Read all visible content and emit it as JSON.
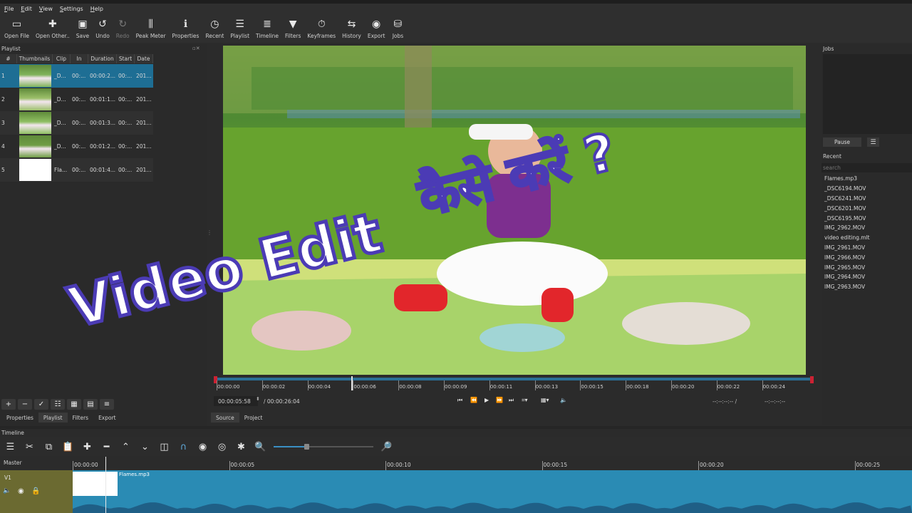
{
  "menu": [
    "File",
    "Edit",
    "View",
    "Settings",
    "Help"
  ],
  "toolbar": [
    {
      "label": "Open File",
      "icon": "open-file-icon",
      "glyph": "▭",
      "disabled": false
    },
    {
      "label": "Open Other..",
      "icon": "open-other-icon",
      "glyph": "✚",
      "disabled": false
    },
    {
      "label": "Save",
      "icon": "save-icon",
      "glyph": "▣",
      "disabled": false
    },
    {
      "label": "Undo",
      "icon": "undo-icon",
      "glyph": "↺",
      "disabled": false
    },
    {
      "label": "Redo",
      "icon": "redo-icon",
      "glyph": "↻",
      "disabled": true
    },
    {
      "label": "Peak Meter",
      "icon": "peak-meter-icon",
      "glyph": "⫼",
      "disabled": false
    },
    {
      "label": "Properties",
      "icon": "properties-icon",
      "glyph": "ℹ",
      "disabled": false
    },
    {
      "label": "Recent",
      "icon": "recent-icon",
      "glyph": "◷",
      "disabled": false
    },
    {
      "label": "Playlist",
      "icon": "playlist-icon",
      "glyph": "☰",
      "disabled": false
    },
    {
      "label": "Timeline",
      "icon": "timeline-icon",
      "glyph": "≣",
      "disabled": false
    },
    {
      "label": "Filters",
      "icon": "filters-icon",
      "glyph": "▼",
      "disabled": false
    },
    {
      "label": "Keyframes",
      "icon": "keyframes-icon",
      "glyph": "⏱",
      "disabled": false
    },
    {
      "label": "History",
      "icon": "history-icon",
      "glyph": "⇆",
      "disabled": false
    },
    {
      "label": "Export",
      "icon": "export-icon",
      "glyph": "◉",
      "disabled": false
    },
    {
      "label": "Jobs",
      "icon": "jobs-icon",
      "glyph": "⛁",
      "disabled": false
    }
  ],
  "playlist": {
    "title": "Playlist",
    "columns": [
      "#",
      "Thumbnails",
      "Clip",
      "In",
      "Duration",
      "Start",
      "Date"
    ],
    "rows": [
      {
        "n": "1",
        "clip": "_D...",
        "in": "00:...",
        "duration": "00:00:2...",
        "start": "00:...",
        "date": "201...",
        "thumb": "#7fb35a"
      },
      {
        "n": "2",
        "clip": "_D...",
        "in": "00:...",
        "duration": "00:01:1...",
        "start": "00:...",
        "date": "201...",
        "thumb": "#9cc06a"
      },
      {
        "n": "3",
        "clip": "_D...",
        "in": "00:...",
        "duration": "00:01:3...",
        "start": "00:...",
        "date": "201...",
        "thumb": "#8fbf62"
      },
      {
        "n": "4",
        "clip": "_D...",
        "in": "00:...",
        "duration": "00:01:2...",
        "start": "00:...",
        "date": "201...",
        "thumb": "#6f9d45"
      },
      {
        "n": "5",
        "clip": "Fla...",
        "in": "00:...",
        "duration": "00:01:4...",
        "start": "00:...",
        "date": "201...",
        "thumb": "#ffffff"
      }
    ],
    "footer_tabs": [
      "Properties",
      "Playlist",
      "Filters",
      "Export"
    ]
  },
  "overlay": {
    "line1": "Video Edit",
    "line2": "कैसे करें ?"
  },
  "player": {
    "ruler_ticks": [
      "00:00:00",
      "00:00:02",
      "00:00:04",
      "00:00:06",
      "00:00:08",
      "00:00:09",
      "00:00:11",
      "00:00:13",
      "00:00:15",
      "00:00:18",
      "00:00:20",
      "00:00:22",
      "00:00:24"
    ],
    "current_time": "00:00:05:58",
    "total_time": "/ 00:00:26:04",
    "in_point": "--:--:--:-- /",
    "out_point": "--:--:--:--",
    "tabs": [
      "Source",
      "Project"
    ]
  },
  "jobs": {
    "title": "Jobs",
    "pause_label": "Pause",
    "menu_glyph": "☰"
  },
  "recent": {
    "title": "Recent",
    "search_placeholder": "search",
    "items": [
      "Flames.mp3",
      "_DSC6194.MOV",
      "_DSC6241.MOV",
      "_DSC6201.MOV",
      "_DSC6195.MOV",
      "IMG_2962.MOV",
      "video editing.mlt",
      "IMG_2961.MOV",
      "IMG_2966.MOV",
      "IMG_2965.MOV",
      "IMG_2964.MOV",
      "IMG_2963.MOV"
    ]
  },
  "timeline": {
    "title": "Timeline",
    "master_label": "Master",
    "track_name": "V1",
    "clip_name": "Flames.mp3",
    "ruler_ticks": [
      "00:00:00",
      "00:00:05",
      "00:00:10",
      "00:00:15",
      "00:00:20",
      "00:00:25"
    ]
  },
  "colors": {
    "accent_blue": "#2a8bb4",
    "selection": "#1e6e94",
    "overlay_purple": "#4b3bb5"
  }
}
